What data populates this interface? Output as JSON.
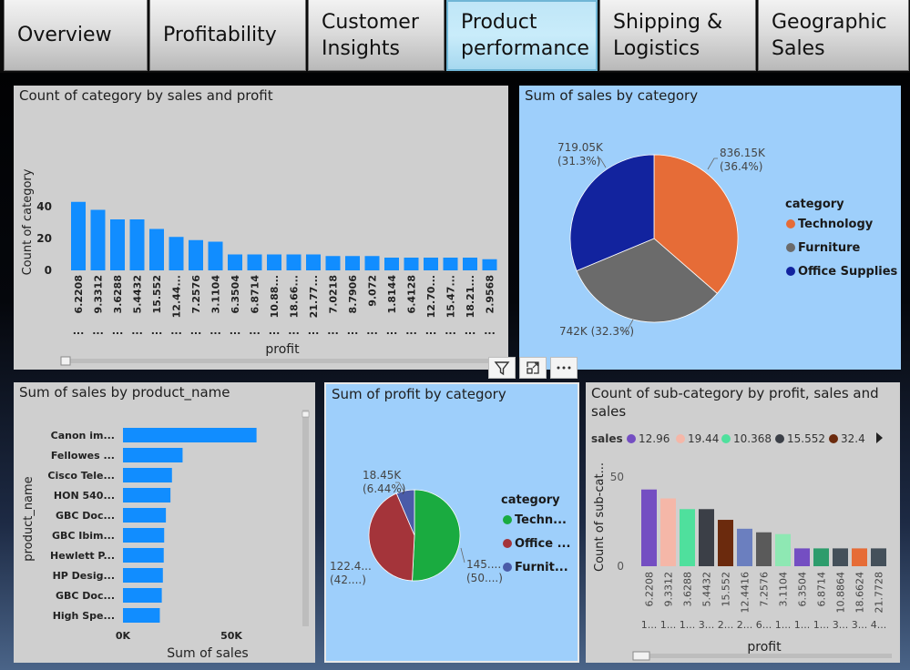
{
  "nav": {
    "tabs": [
      {
        "label": "Overview"
      },
      {
        "label": "Profitability"
      },
      {
        "label": "Customer\nInsights"
      },
      {
        "label": "Product\nperformance"
      },
      {
        "label": "Shipping &\nLogistics"
      },
      {
        "label": "Geographic\nSales"
      }
    ],
    "active_index": 3
  },
  "visual_header": {
    "icons": [
      "filter-icon",
      "focus-mode-icon",
      "more-options-icon"
    ]
  },
  "colors": {
    "bar_blue": "#118dff",
    "technology": "#e66c37",
    "furniture": "#6b6b6b",
    "office_supplies": "#12239e",
    "profit_technology": "#1aab40",
    "profit_office": "#a4343a",
    "profit_furniture": "#4a5ba8"
  },
  "chart_data": [
    {
      "id": "count-category-chart",
      "type": "bar",
      "title": "Count of category by sales and profit",
      "xlabel": "profit",
      "ylabel": "Count of category",
      "yticks": [
        "0",
        "20",
        "40"
      ],
      "ylim": [
        0,
        45
      ],
      "categories": [
        "6.2208",
        "9.3312",
        "3.6288",
        "5.4432",
        "15.552",
        "12.44...",
        "7.2576",
        "3.1104",
        "6.3504",
        "6.8714",
        "10.88...",
        "18.66...",
        "21.77...",
        "7.0218",
        "8.7906",
        "9.072",
        "1.8144",
        "6.4128",
        "12.70...",
        "15.47...",
        "18.21...",
        "2.9568"
      ],
      "sub_labels": [
        "...",
        "...",
        "...",
        "...",
        "...",
        "...",
        "...",
        "...",
        "...",
        "...",
        "...",
        "...",
        "...",
        "...",
        "...",
        "...",
        "...",
        "...",
        "...",
        "...",
        "...",
        "..."
      ],
      "values": [
        43,
        38,
        32,
        32,
        26,
        21,
        19,
        18,
        10,
        10,
        10,
        10,
        10,
        9,
        9,
        9,
        8,
        8,
        8,
        8,
        8,
        7
      ]
    },
    {
      "id": "sales-by-category-pie",
      "type": "pie",
      "title": "Sum of sales by category",
      "legend_title": "category",
      "categories": [
        "Technology",
        "Furniture",
        "Office Supplies"
      ],
      "values": [
        836.15,
        742,
        719.05
      ],
      "labels": [
        "836.15K\n(36.4%)",
        "742K (32.3%)",
        "719.05K\n(31.3%)"
      ]
    },
    {
      "id": "sales-by-product-chart",
      "type": "bar",
      "title": "Sum of sales by product_name",
      "xlabel": "Sum of sales",
      "ylabel": "product_name",
      "xticks": [
        "0K",
        "50K"
      ],
      "xlim": [
        0,
        80
      ],
      "categories": [
        "Canon im...",
        "Fellowes ...",
        "Cisco Tele...",
        "HON 540...",
        "GBC Doc...",
        "GBC Ibim...",
        "Hewlett P...",
        "HP Desig...",
        "GBC Doc...",
        "High Spe..."
      ],
      "values": [
        61.6,
        27.5,
        22.6,
        21.9,
        19.8,
        19.0,
        18.8,
        18.4,
        17.9,
        17.0
      ]
    },
    {
      "id": "profit-by-category-pie",
      "type": "pie",
      "title": "Sum of profit by category",
      "legend_title": "category",
      "categories": [
        "Techn...",
        "Office ...",
        "Furnit..."
      ],
      "values": [
        145.45,
        122.49,
        18.45
      ],
      "labels": [
        "145....\n(50....)",
        "122.4...\n(42....)",
        "18.45K\n(6.44%)"
      ]
    },
    {
      "id": "count-subcategory-chart",
      "type": "bar",
      "title": "Count of sub-category by profit, sales and\nsales",
      "xlabel": "profit",
      "ylabel": "Count of sub-cat...",
      "legend_label": "sales",
      "legend": [
        "12.96",
        "19.44",
        "10.368",
        "15.552",
        "32.4"
      ],
      "yticks": [
        "0",
        "50"
      ],
      "ylim": [
        0,
        55
      ],
      "categories": [
        "6.2208",
        "9.3312",
        "3.6288",
        "5.4432",
        "15.552",
        "12.4416",
        "7.2576",
        "3.1104",
        "6.3504",
        "6.8714",
        "10.8864",
        "18.6624",
        "21.7728"
      ],
      "sub_labels": [
        "1...",
        "1...",
        "1...",
        "3...",
        "2...",
        "2...",
        "6...",
        "1...",
        "1...",
        "1...",
        "3...",
        "3...",
        "4..."
      ],
      "values": [
        43,
        38,
        32,
        32,
        26,
        21,
        19,
        18,
        10,
        10,
        10,
        10,
        10
      ],
      "bar_colors": [
        "#744ec2",
        "#f5b7a8",
        "#4fe09d",
        "#3b3f47",
        "#6b2a0d",
        "#6b7fbf",
        "#5a5a5a",
        "#8ee8b3",
        "#744ec2",
        "#2d9c6c",
        "#44505a",
        "#e66c37",
        "#44505a"
      ]
    }
  ]
}
